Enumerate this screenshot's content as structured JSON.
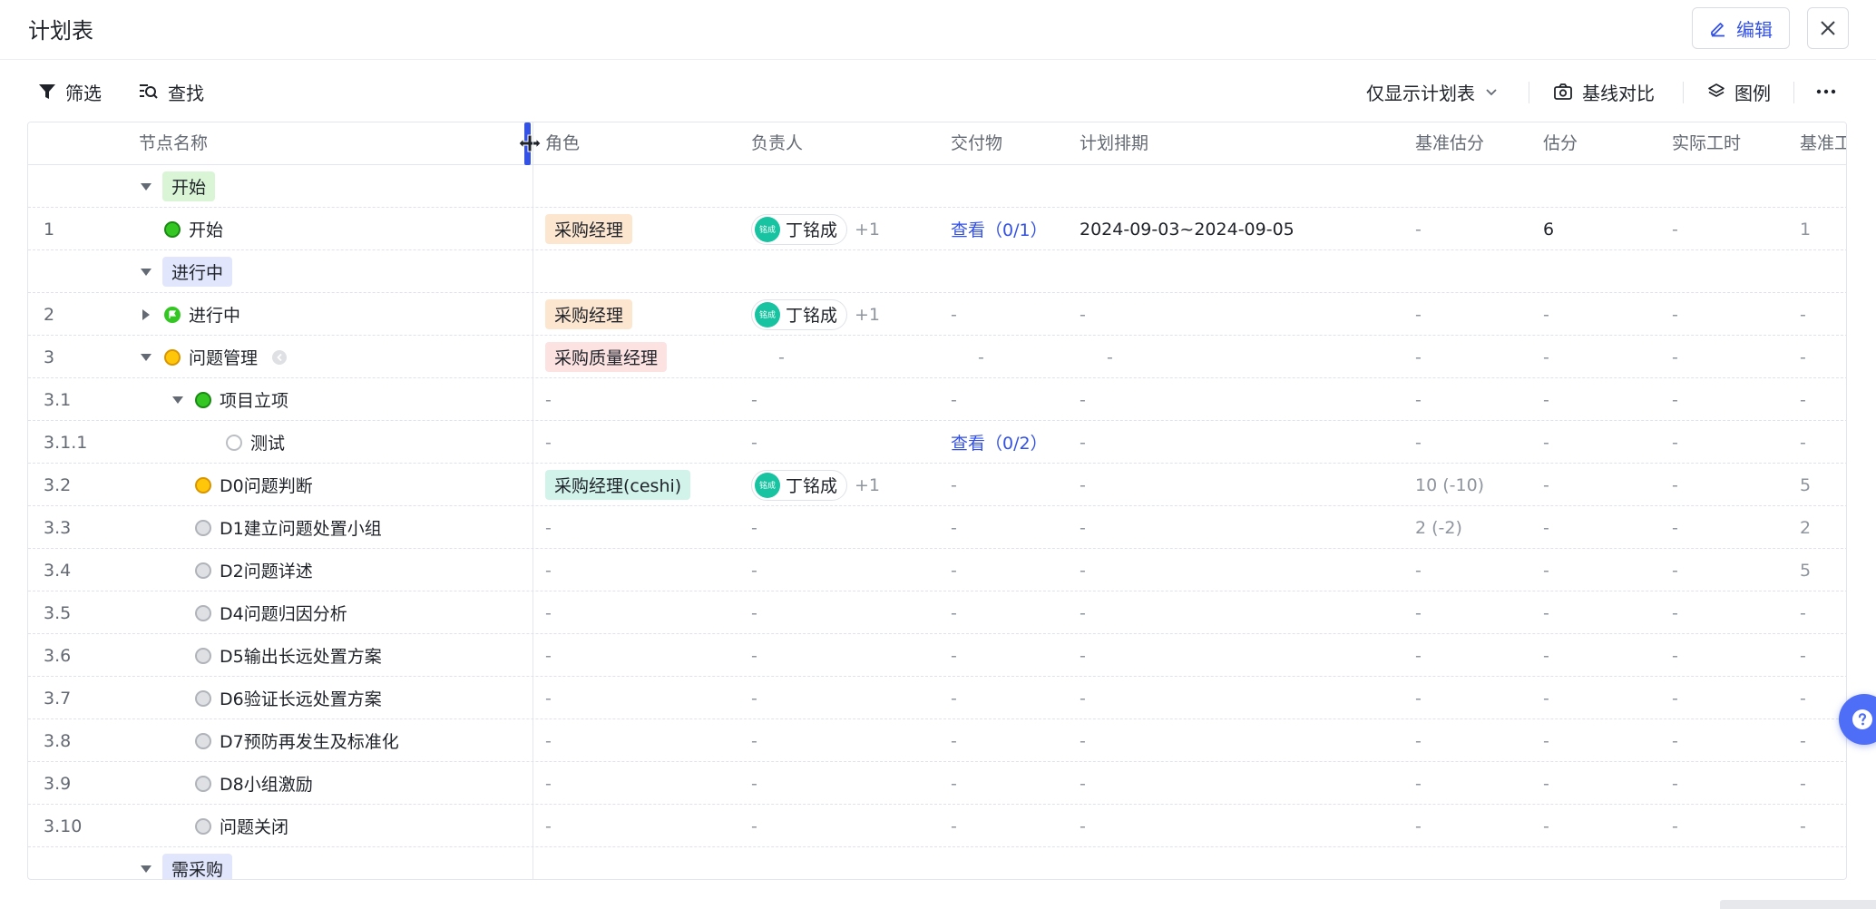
{
  "header": {
    "title": "计划表",
    "edit_label": "编辑"
  },
  "toolbar": {
    "filter_label": "筛选",
    "find_label": "查找",
    "view_select": "仅显示计划表",
    "baseline_label": "基线对比",
    "legend_label": "图例"
  },
  "table": {
    "columns": {
      "name": "节点名称",
      "role": "角色",
      "owner": "负责人",
      "deliverable": "交付物",
      "schedule": "计划排期",
      "base_estimate": "基准估分",
      "estimate": "估分",
      "actual_hours": "实际工时",
      "base_hours": "基准工"
    },
    "dash": "-",
    "owner_name": "丁铭成",
    "owner_avatar_text": "铭成",
    "owner_extra": "+1",
    "groups": {
      "start": "开始",
      "in_progress": "进行中",
      "need_purchase": "需采购"
    },
    "rows": {
      "r1": {
        "no": "1",
        "name": "开始",
        "role": "采购经理",
        "deliverable": "查看（0/1）",
        "schedule": "2024-09-03~2024-09-05",
        "base_estimate": "-",
        "estimate": "6",
        "actual_hours": "-",
        "base_hours": "1"
      },
      "r2": {
        "no": "2",
        "name": "进行中",
        "role": "采购经理"
      },
      "r3": {
        "no": "3",
        "name": "问题管理",
        "role": "采购质量经理"
      },
      "r31": {
        "no": "3.1",
        "name": "项目立项"
      },
      "r311": {
        "no": "3.1.1",
        "name": "测试",
        "deliverable": "查看（0/2）"
      },
      "r32": {
        "no": "3.2",
        "name": "D0问题判断",
        "role": "采购经理(ceshi)",
        "base_estimate": "10 (-10)",
        "base_hours": "5"
      },
      "r33": {
        "no": "3.3",
        "name": "D1建立问题处置小组",
        "base_estimate": "2 (-2)",
        "base_hours": "2"
      },
      "r34": {
        "no": "3.4",
        "name": "D2问题详述",
        "base_hours": "5"
      },
      "r35": {
        "no": "3.5",
        "name": "D4问题归因分析"
      },
      "r36": {
        "no": "3.6",
        "name": "D5输出长远处置方案"
      },
      "r37": {
        "no": "3.7",
        "name": "D6验证长远处置方案"
      },
      "r38": {
        "no": "3.8",
        "name": "D7预防再发生及标准化"
      },
      "r39": {
        "no": "3.9",
        "name": "D8小组激励"
      },
      "r310": {
        "no": "3.10",
        "name": "问题关闭"
      }
    }
  },
  "colors": {
    "accent": "#3452e6",
    "tag_green_bg": "#d9f5d6",
    "tag_blue_bg": "#e1e6fc",
    "role_orange_bg": "#fde6cf",
    "role_red_bg": "#fde2e2",
    "role_teal_bg": "#d2f3ea"
  }
}
